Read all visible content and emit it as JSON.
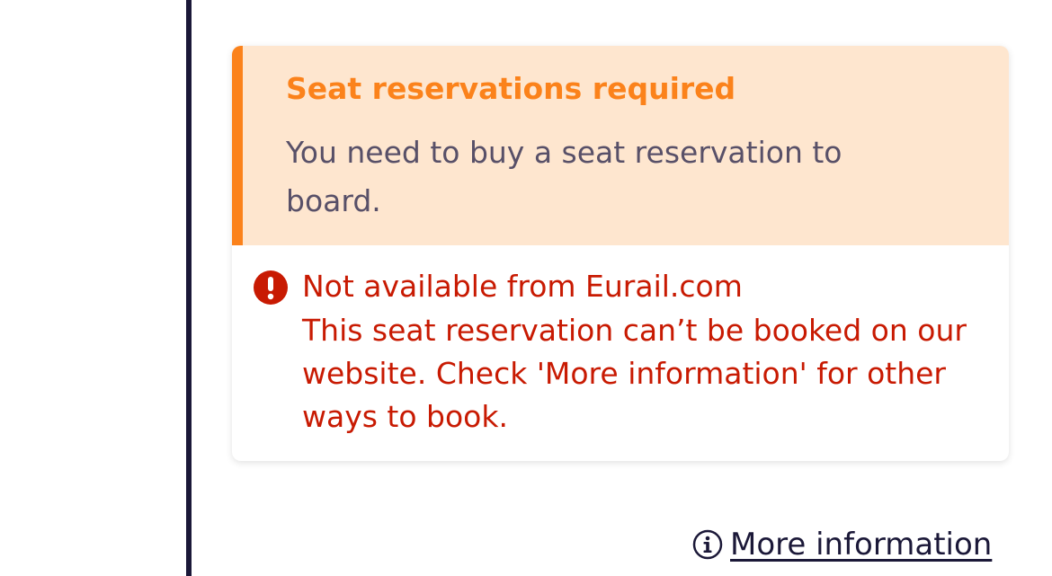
{
  "warning": {
    "title": "Seat reservations required",
    "text": "You need to buy a seat reservation to board."
  },
  "error": {
    "icon": "exclamation-circle-icon",
    "title": "Not available from Eurail.com",
    "text": "This seat reservation can’t be booked on our website. Check 'More information' for other ways to book."
  },
  "more_info": {
    "icon": "info-circle-icon",
    "label": "More information"
  },
  "colors": {
    "warning_accent": "#fb821b",
    "warning_background": "#fee6cf",
    "error": "#c81a02",
    "timeline": "#1b1838"
  }
}
